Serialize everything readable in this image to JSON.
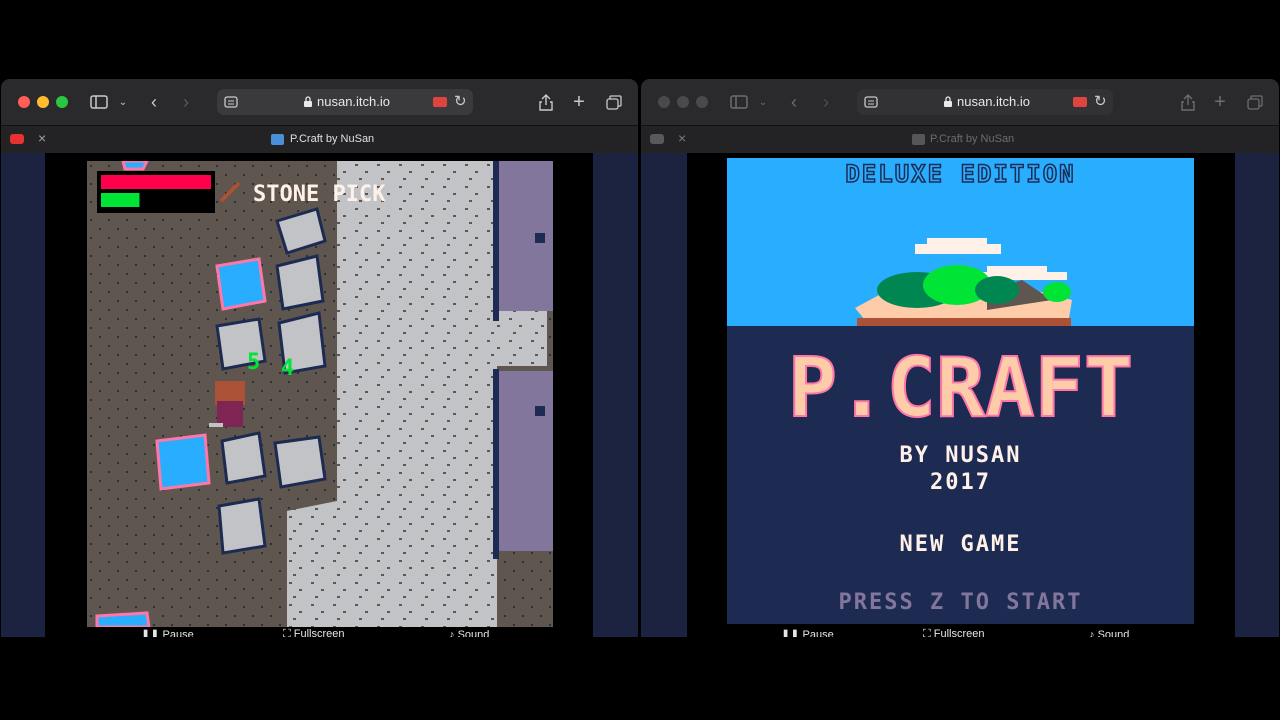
{
  "left_window": {
    "url": "nusan.itch.io",
    "tab_title": "P.Craft by NuSan",
    "hud_item": "STONE PICK",
    "damage_numbers": [
      "5",
      "4"
    ],
    "health_fraction": 1.0,
    "stamina_fraction": 0.35,
    "controls": [
      "Pause",
      "Fullscreen",
      "Sound"
    ]
  },
  "right_window": {
    "url": "nusan.itch.io",
    "tab_title": "P.Craft by NuSan",
    "edition_text": "DELUXE EDITION",
    "game_title": "P.CRAFT",
    "byline": "BY NUSAN",
    "year": "2017",
    "menu_item": "NEW GAME",
    "prompt": "PRESS Z TO START",
    "controls": [
      "Pause",
      "Fullscreen",
      "Sound"
    ]
  },
  "colors": {
    "close": "#ff5f57",
    "minimize": "#febc2e",
    "zoom": "#28c840",
    "sky": "#29adff",
    "sea": "#1d2b53",
    "title_peach": "#ffccaa",
    "title_blue": "#29adff"
  },
  "icons": [
    "sidebar-icon",
    "back-icon",
    "forward-icon",
    "reader-icon",
    "lock-icon",
    "share-icon",
    "new-tab-icon",
    "tabs-overview-icon",
    "reload-icon",
    "youtube-icon",
    "close-icon"
  ]
}
